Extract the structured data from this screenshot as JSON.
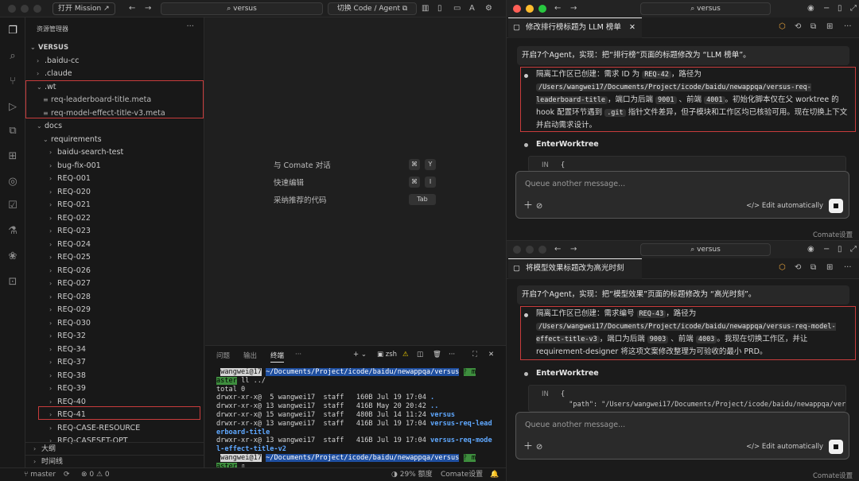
{
  "left_window": {
    "titlebar": {
      "mission_button": "打开 Mission",
      "search": "versus",
      "toggle_button": "切换 Code / Agent"
    },
    "sidebar": {
      "header": "资源管理器",
      "more": "···",
      "tree": [
        {
          "label": "VERSUS",
          "depth": 0,
          "state": "open",
          "bold": true
        },
        {
          "label": ".baidu-cc",
          "depth": 1,
          "state": "closed"
        },
        {
          "label": ".claude",
          "depth": 1,
          "state": "closed"
        },
        {
          "label": ".wt",
          "depth": 1,
          "state": "open"
        },
        {
          "label": "req-leaderboard-title.meta",
          "depth": 2,
          "state": "file"
        },
        {
          "label": "req-model-effect-title-v3.meta",
          "depth": 2,
          "state": "file"
        },
        {
          "label": "docs",
          "depth": 1,
          "state": "open"
        },
        {
          "label": "requirements",
          "depth": 2,
          "state": "open"
        },
        {
          "label": "baidu-search-test",
          "depth": 3,
          "state": "closed"
        },
        {
          "label": "bug-fix-001",
          "depth": 3,
          "state": "closed"
        },
        {
          "label": "REQ-001",
          "depth": 3,
          "state": "closed"
        },
        {
          "label": "REQ-020",
          "depth": 3,
          "state": "closed"
        },
        {
          "label": "REQ-021",
          "depth": 3,
          "state": "closed"
        },
        {
          "label": "REQ-022",
          "depth": 3,
          "state": "closed"
        },
        {
          "label": "REQ-023",
          "depth": 3,
          "state": "closed"
        },
        {
          "label": "REQ-024",
          "depth": 3,
          "state": "closed"
        },
        {
          "label": "REQ-025",
          "depth": 3,
          "state": "closed"
        },
        {
          "label": "REQ-026",
          "depth": 3,
          "state": "closed"
        },
        {
          "label": "REQ-027",
          "depth": 3,
          "state": "closed"
        },
        {
          "label": "REQ-028",
          "depth": 3,
          "state": "closed"
        },
        {
          "label": "REQ-029",
          "depth": 3,
          "state": "closed"
        },
        {
          "label": "REQ-030",
          "depth": 3,
          "state": "closed"
        },
        {
          "label": "REQ-32",
          "depth": 3,
          "state": "closed"
        },
        {
          "label": "REQ-34",
          "depth": 3,
          "state": "closed"
        },
        {
          "label": "REQ-37",
          "depth": 3,
          "state": "closed"
        },
        {
          "label": "REQ-38",
          "depth": 3,
          "state": "closed"
        },
        {
          "label": "REQ-39",
          "depth": 3,
          "state": "closed"
        },
        {
          "label": "REQ-40",
          "depth": 3,
          "state": "closed"
        },
        {
          "label": "REQ-41",
          "depth": 3,
          "state": "closed"
        },
        {
          "label": "REQ-CASE-RESOURCE",
          "depth": 3,
          "state": "closed"
        },
        {
          "label": "REQ-CASESET-OPT",
          "depth": 3,
          "state": "closed"
        }
      ],
      "outline": "大纲",
      "timeline": "时间线"
    },
    "editor_hints": [
      {
        "label": "与 Comate 对话",
        "keys": [
          "⌘",
          "Y"
        ]
      },
      {
        "label": "快速编辑",
        "keys": [
          "⌘",
          "I"
        ]
      },
      {
        "label": "采纳推荐的代码",
        "keys": [
          "Tab"
        ]
      }
    ],
    "panel": {
      "tabs": [
        "问题",
        "输出",
        "终端",
        "···"
      ],
      "shell": "zsh",
      "terminal": {
        "user": "wangwei@17",
        "path": "~/Documents/Project/icode/baidu/newappqa/versus",
        "branch_a": "ᚹ m",
        "branch_b": "aster",
        "command": "ll ../",
        "total": "total 0",
        "rows": [
          {
            "meta": "drwxr-xr-x@  5 wangwei17  staff   160B Jul 19 17:04 ",
            "name": "."
          },
          {
            "meta": "drwxr-xr-x@ 13 wangwei17  staff   416B May 20 20:42 ",
            "name": ".."
          },
          {
            "meta": "drwxr-xr-x@ 15 wangwei17  staff   480B Jul 14 11:24 ",
            "name": "versus"
          },
          {
            "meta": "drwxr-xr-x@ 13 wangwei17  staff   416B Jul 19 17:04 ",
            "name": "versus-req-lead",
            "cont": "erboard-title"
          },
          {
            "meta": "drwxr-xr-x@ 13 wangwei17  staff   416B Jul 19 17:04 ",
            "name": "versus-req-mode",
            "cont": "l-effect-title-v2"
          }
        ]
      }
    },
    "statusbar": {
      "branch": "master",
      "problems": "⊗ 0 ⚠ 0",
      "quota": "29% 额度",
      "settings": "Comate设置"
    }
  },
  "right_top": {
    "search": "versus",
    "tab_title": "修改排行榜标题为 LLM 榜单",
    "prompt": "开启7个Agent，实现：把“排行榜”页面的标题修改为 “LLM 榜单”。",
    "msg_parts": [
      "隔离工作区已创建：需求 ID 为 ",
      "REQ-42",
      "，路径为 ",
      "/Users/wangwei17/Documents/Project/icode/baidu/newappqa/versus-req-leaderboard-title",
      "，端口为后端 ",
      "9001",
      " 、前端 ",
      "4001",
      "。初始化脚本仅在父 worktree 的 hook 配置环节遇到 ",
      ".git",
      " 指针文件差异，但子模块和工作区均已核验可用。现在切换上下文并启动需求设计。"
    ],
    "tool_name": "EnterWorktree",
    "tool_in": "IN",
    "tool_code": "{",
    "input_placeholder": "Queue another message...",
    "edit_auto": "Edit automatically",
    "footer": "Comate设置"
  },
  "right_bottom": {
    "search": "versus",
    "tab_title": "将模型效果标题改为高光时刻",
    "prompt": "开启7个Agent，实现：把“模型效果”页面的标题修改为 “高光时刻”。",
    "msg_parts": [
      "隔离工作区已创建：需求编号 ",
      "REQ-43",
      "，路径为 ",
      "/Users/wangwei17/Documents/Project/icode/baidu/newappqa/versus-req-model-effect-title-v3",
      "，端口为后端 ",
      "9003",
      " 、前端 ",
      "4003",
      "。我现在切换工作区，并让 requirement-designer 将这项文案修改整理为可验收的最小 PRD。"
    ],
    "tool_name": "EnterWorktree",
    "tool_in": "IN",
    "tool_code": "{",
    "tool_code2": "  \"path\": \"/Users/wangwei17/Documents/Project/icode/baidu/newappqa/vers",
    "input_placeholder": "Queue another message...",
    "edit_auto": "Edit automatically",
    "footer": "Comate设置"
  }
}
